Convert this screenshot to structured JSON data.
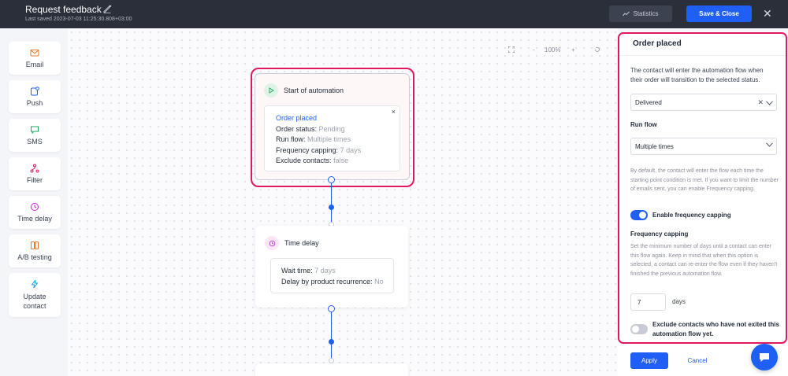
{
  "header": {
    "title": "Request feedback",
    "last_saved": "Last saved 2023-07-03 11:25:30.808+03:00",
    "statistics_label": "Statistics",
    "save_close_label": "Save & Close",
    "close_symbol": "✕"
  },
  "sidebar": {
    "items": [
      {
        "label": "Email",
        "icon": "envelope-icon",
        "color": "#e8762d"
      },
      {
        "label": "Push",
        "icon": "push-icon",
        "color": "#1f5ff5"
      },
      {
        "label": "SMS",
        "icon": "chat-bubble-icon",
        "color": "#22a45d"
      },
      {
        "label": "Filter",
        "icon": "filter-icon",
        "color": "#e0195e"
      },
      {
        "label": "Time delay",
        "icon": "clock-icon",
        "color": "#c026d3"
      },
      {
        "label": "A/B testing",
        "icon": "ab-testing-icon",
        "color": "#e8762d"
      },
      {
        "label": "Update contact",
        "icon": "lightning-icon",
        "color": "#0ea5e9"
      }
    ]
  },
  "zoom": {
    "level": "100%",
    "minus": "-",
    "plus": "+"
  },
  "start_node": {
    "title": "Start of automation",
    "trigger": "Order placed",
    "remove_symbol": "×",
    "status_label": "Order status:",
    "status_value": "Pending",
    "run_label": "Run flow:",
    "run_value": "Multiple times",
    "freq_label": "Frequency capping:",
    "freq_value": "7 days",
    "exclude_label": "Exclude contacts:",
    "exclude_value": "false"
  },
  "delay_node": {
    "title": "Time delay",
    "wait_label": "Wait time:",
    "wait_value": "7 days",
    "recurrence_label": "Delay by product recurrence:",
    "recurrence_value": "No"
  },
  "panel": {
    "title": "Order placed",
    "intro": "The contact will enter the automation flow when their order will transition to the selected status.",
    "status_selected": "Delivered",
    "run_flow_label": "Run flow",
    "run_flow_selected": "Multiple times",
    "help_text": "By default, the contact will enter the flow each time the starting point condition is met. If you want to limit the number of emails sent, you can enable Frequency capping.",
    "enable_capping_label": "Enable frequency capping",
    "capping_label": "Frequency capping",
    "capping_help": "Set the minimum number of days until a contact can enter this flow again. Keep in mind that when this option is selected, a contact can re-enter the flow even if they haven't finished the previous automation flow.",
    "days_value": "7",
    "days_unit": "days",
    "exclude_label": "Exclude contacts who have not exited this automation flow yet.",
    "apply_label": "Apply",
    "cancel_label": "Cancel"
  },
  "colors": {
    "accent": "#1f5ff5",
    "highlight": "#e0195e",
    "topbar": "#2b2f3a"
  }
}
